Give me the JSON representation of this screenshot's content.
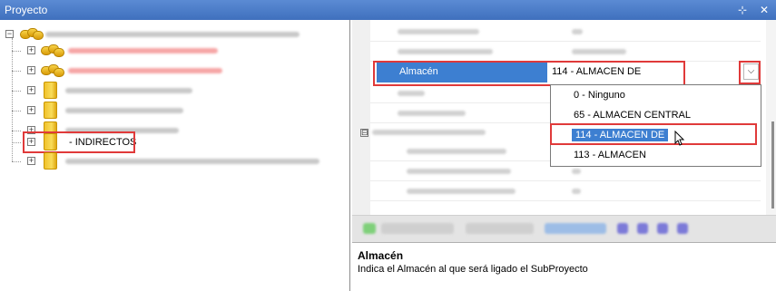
{
  "window": {
    "title": "Proyecto",
    "pin_glyph": "⊹",
    "close_glyph": "✕"
  },
  "tree": {
    "expand_glyph": "+",
    "collapse_glyph": "−",
    "visible_node_label": "- INDIRECTOS"
  },
  "properties": {
    "collapse_glyph": "⊟",
    "selected_property": {
      "name": "Almacén",
      "value": "114 - ALMACEN DE"
    },
    "dropdown_arrow": "⌵"
  },
  "dropdown": {
    "options": [
      {
        "label": "0 - Ninguno"
      },
      {
        "label": "65 - ALMACEN CENTRAL"
      },
      {
        "label": "114 - ALMACEN DE"
      },
      {
        "label": "113 - ALMACEN"
      }
    ],
    "selected_index": 2
  },
  "description": {
    "title": "Almacén",
    "text": "Indica el Almacén al que será ligado el SubProyecto"
  },
  "colors": {
    "highlight": "#e03a3a",
    "selection": "#3d7fd1",
    "titlebar": "#4a7cc8"
  }
}
